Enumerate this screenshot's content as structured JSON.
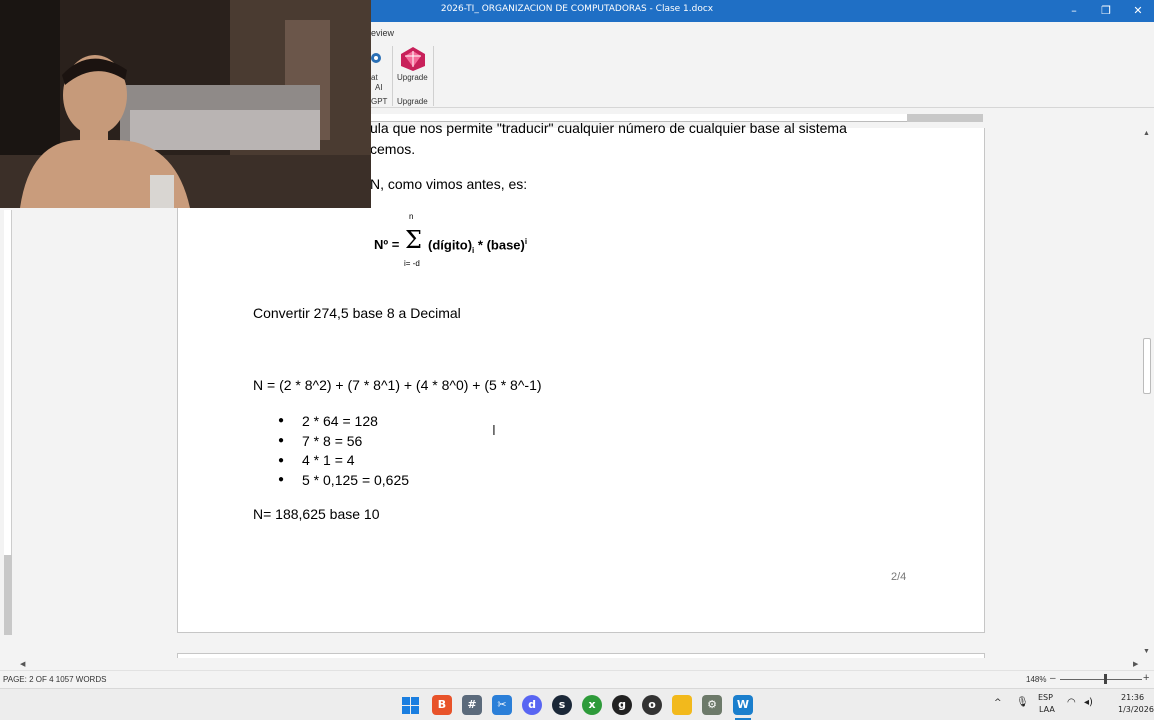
{
  "window": {
    "title": "2026-TI_ ORGANIZACION DE COMPUTADORAS - Clase 1.docx",
    "minimize": "–",
    "restore": "❐",
    "close": "✕"
  },
  "ribbon": {
    "tab_fragment": "eview",
    "chat_fragment_1": "at",
    "chat_fragment_2": "AI",
    "chat_fragment_3": "GPT",
    "upgrade_button": "Upgrade",
    "upgrade_group": "Upgrade"
  },
  "document": {
    "line1": "ula que nos permite \"traducir\" cualquier número de cualquier base al sistema",
    "line2": "cemos.",
    "line3": "N, como vimos antes, es:",
    "formula": {
      "lhs": "Nº =",
      "sigma": "Σ",
      "upper": "n",
      "lower": "i= -d",
      "body": "(dígito)",
      "sub": "i",
      "mid": " * (base)",
      "sup": "i"
    },
    "convert": "Convertir 274,5 base 8 a Decimal",
    "expansion": "N = (2 * 8^2) + (7 * 8^1) + (4 * 8^0) + (5 * 8^-1)",
    "bullets": [
      "2 * 64 = 128",
      "7 * 8 = 56",
      "4 * 1 = 4",
      "5 * 0,125 = 0,625"
    ],
    "result": "N= 188,625 base 10",
    "page_number": "2/4"
  },
  "status": {
    "page_info": "PAGE: 2 OF 4   1057 WORDS",
    "zoom": "148%",
    "zoom_out": "–",
    "zoom_in": "+",
    "zoom_level": 0.55
  },
  "taskbar": {
    "lang_1": "ESP",
    "lang_2": "LAA",
    "time": "21:36",
    "date": "1/3/2026",
    "icons": [
      "windows-icon",
      "brave-icon",
      "calculator-icon",
      "snipping-icon",
      "discord-icon",
      "steam-icon",
      "xbox-icon",
      "github-icon",
      "obs-icon",
      "file-explorer-icon",
      "settings-icon",
      "writer-icon"
    ]
  },
  "colors": {
    "titlebar": "#1f6fc5",
    "upgrade": "#c8205a"
  }
}
